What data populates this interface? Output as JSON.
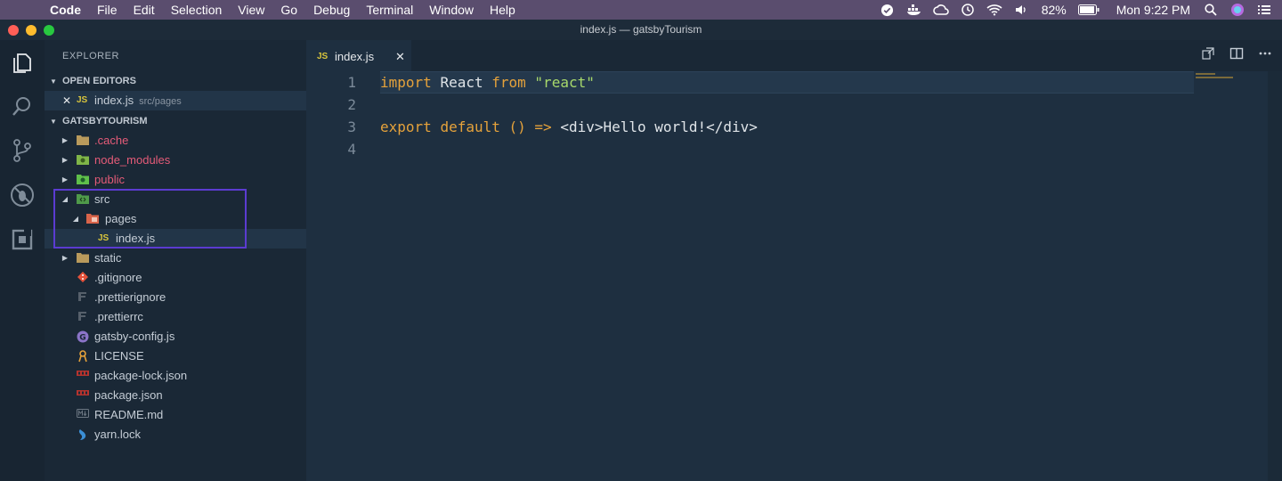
{
  "menubar": {
    "items": [
      "Code",
      "File",
      "Edit",
      "Selection",
      "View",
      "Go",
      "Debug",
      "Terminal",
      "Window",
      "Help"
    ],
    "battery": "82%",
    "clock": "Mon 9:22 PM"
  },
  "window": {
    "title": "index.js — gatsbyTourism"
  },
  "explorer": {
    "title": "EXPLORER",
    "open_editors_header": "OPEN EDITORS",
    "open_editor": {
      "name": "index.js",
      "path": "src/pages"
    },
    "project_header": "GATSBYTOURISM",
    "tree": [
      {
        "label": ".cache",
        "kind": "folder",
        "ignored": true
      },
      {
        "label": "node_modules",
        "kind": "folder-node",
        "ignored": true
      },
      {
        "label": "public",
        "kind": "folder-public",
        "ignored": true
      },
      {
        "label": "src",
        "kind": "folder-src",
        "ignored": false
      },
      {
        "label": "pages",
        "kind": "folder-pages",
        "ignored": false
      },
      {
        "label": "index.js",
        "kind": "js-file",
        "ignored": false
      },
      {
        "label": "static",
        "kind": "folder",
        "ignored": false
      },
      {
        "label": ".gitignore",
        "kind": "git-file",
        "ignored": false
      },
      {
        "label": ".prettierignore",
        "kind": "prettier-file",
        "ignored": false
      },
      {
        "label": ".prettierrc",
        "kind": "prettier-file",
        "ignored": false
      },
      {
        "label": "gatsby-config.js",
        "kind": "gatsby-file",
        "ignored": false
      },
      {
        "label": "LICENSE",
        "kind": "license-file",
        "ignored": false
      },
      {
        "label": "package-lock.json",
        "kind": "npm-file",
        "ignored": false
      },
      {
        "label": "package.json",
        "kind": "npm-file",
        "ignored": false
      },
      {
        "label": "README.md",
        "kind": "markdown-file",
        "ignored": false
      },
      {
        "label": "yarn.lock",
        "kind": "yarn-file",
        "ignored": false
      }
    ]
  },
  "editor": {
    "tab": {
      "badge": "JS",
      "name": "index.js"
    },
    "line_numbers": [
      "1",
      "2",
      "3",
      "4"
    ],
    "code": {
      "l1_kw1": "import",
      "l1_ident": "React",
      "l1_kw2": "from",
      "l1_str": "\"react\"",
      "l3_kw1": "export",
      "l3_kw2": "default",
      "l3_parens": "()",
      "l3_arrow": "=>",
      "l3_jsx": "<div>Hello world!</div>"
    }
  },
  "colors": {
    "accent_highlight": "#5b3bd1",
    "keyword": "#e5a23b",
    "string": "#a7d86b",
    "ignored_file": "#e55b78"
  }
}
